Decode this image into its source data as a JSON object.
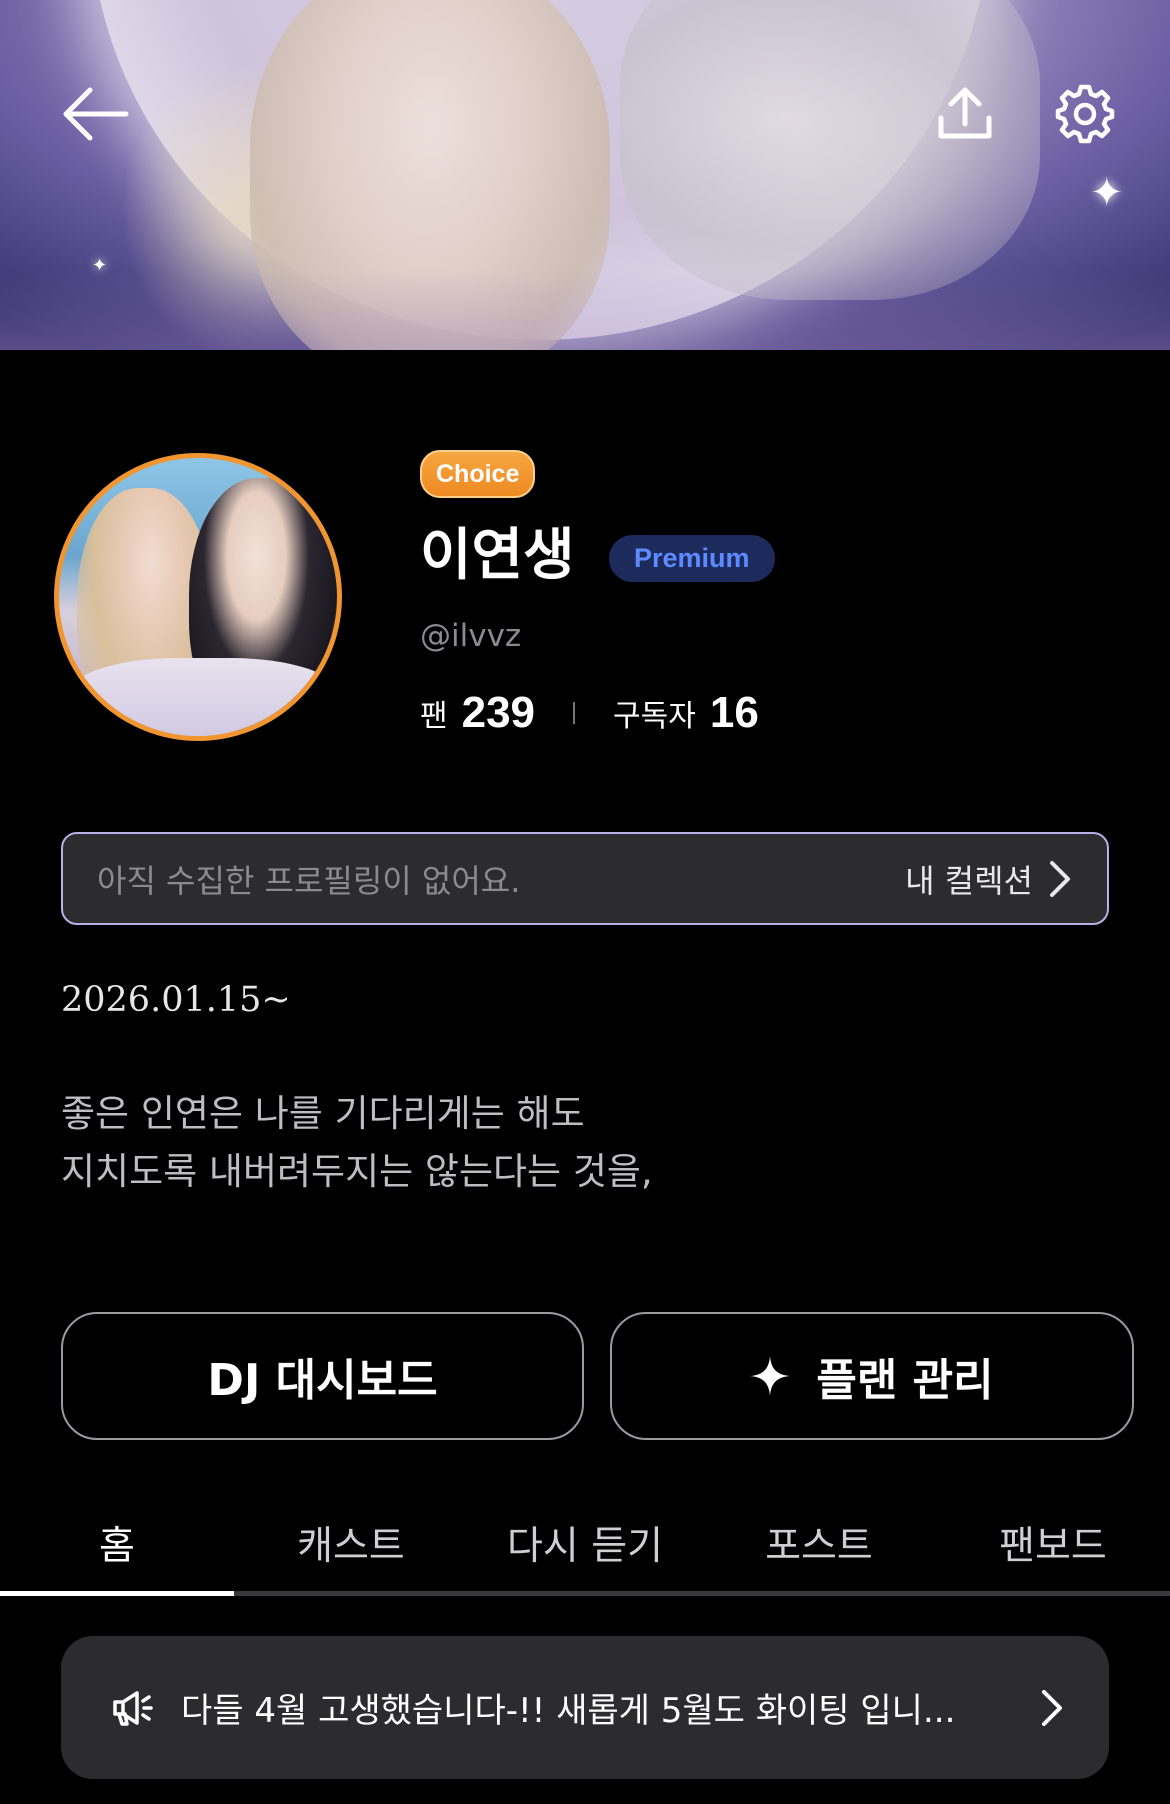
{
  "header": {
    "back_icon": "arrow-left-icon",
    "share_icon": "upload-icon",
    "settings_icon": "gear-icon"
  },
  "profile": {
    "badge": "Choice",
    "name": "이연생",
    "tier": "Premium",
    "handle": "@ilvvz",
    "stats": {
      "fans_label": "팬",
      "fans_value": "239",
      "subs_label": "구독자",
      "subs_value": "16"
    },
    "accent_color": "#f0952f"
  },
  "collection": {
    "message": "아직 수집한 프로필링이 없어요.",
    "link_label": "내 컬렉션"
  },
  "bio": {
    "date": "2026.01.15~",
    "line1": "좋은 인연은 나를 기다리게는 해도",
    "line2": "지치도록 내버려두지는 않는다는 것을,"
  },
  "actions": {
    "dashboard_label": "DJ 대시보드",
    "plan_label": "플랜 관리"
  },
  "tabs": [
    {
      "label": "홈",
      "active": true
    },
    {
      "label": "캐스트",
      "active": false
    },
    {
      "label": "다시 듣기",
      "active": false
    },
    {
      "label": "포스트",
      "active": false
    },
    {
      "label": "팬보드",
      "active": false
    }
  ],
  "notice": {
    "icon": "megaphone-icon",
    "text": "다들 4월 고생했습니다-!! 새롭게 5월도 화이팅 입니..."
  }
}
